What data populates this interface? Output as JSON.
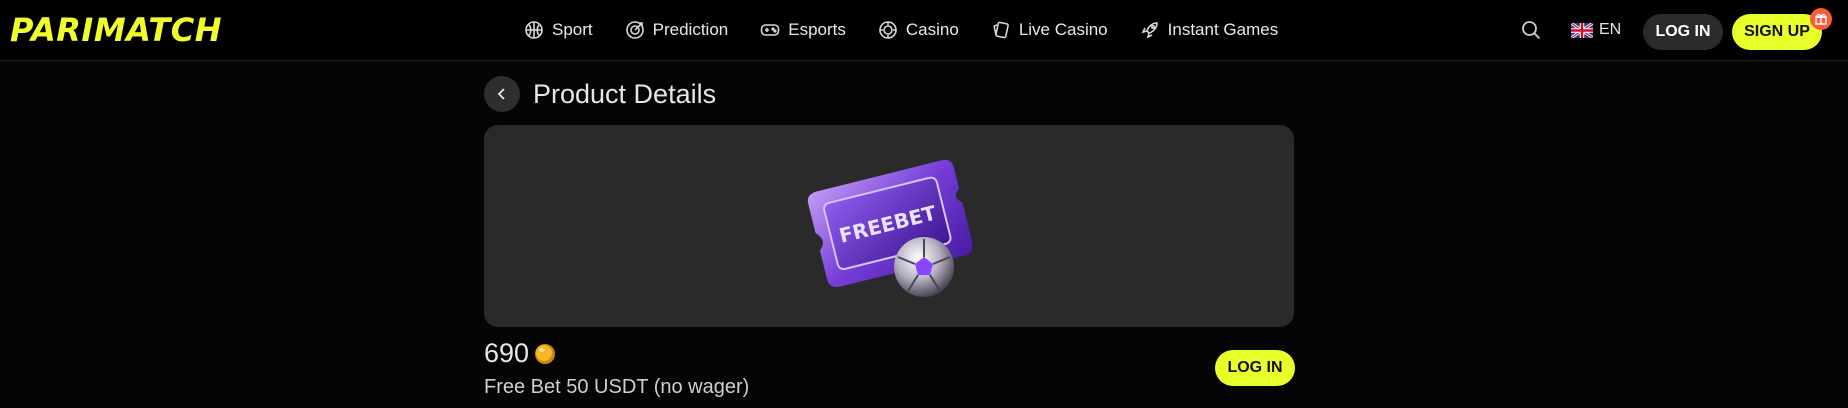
{
  "header": {
    "logo": "PARIMATCH",
    "nav": [
      {
        "label": "Sport",
        "icon": "basketball-icon"
      },
      {
        "label": "Prediction",
        "icon": "target-icon"
      },
      {
        "label": "Esports",
        "icon": "gamepad-icon"
      },
      {
        "label": "Casino",
        "icon": "chip-icon"
      },
      {
        "label": "Live Casino",
        "icon": "cards-icon"
      },
      {
        "label": "Instant Games",
        "icon": "rocket-icon"
      }
    ],
    "language": "EN",
    "login_label": "LOG IN",
    "signup_label": "SIGN UP"
  },
  "page": {
    "title": "Product Details"
  },
  "product": {
    "image_label": "FREEBET",
    "price": "690",
    "name": "Free Bet 50 USDT (no wager)",
    "login_label": "LOG IN"
  },
  "colors": {
    "accent": "#e8ff2a",
    "background": "#050505",
    "card": "#2a2a2a",
    "gift_badge": "#ff5a3c"
  }
}
